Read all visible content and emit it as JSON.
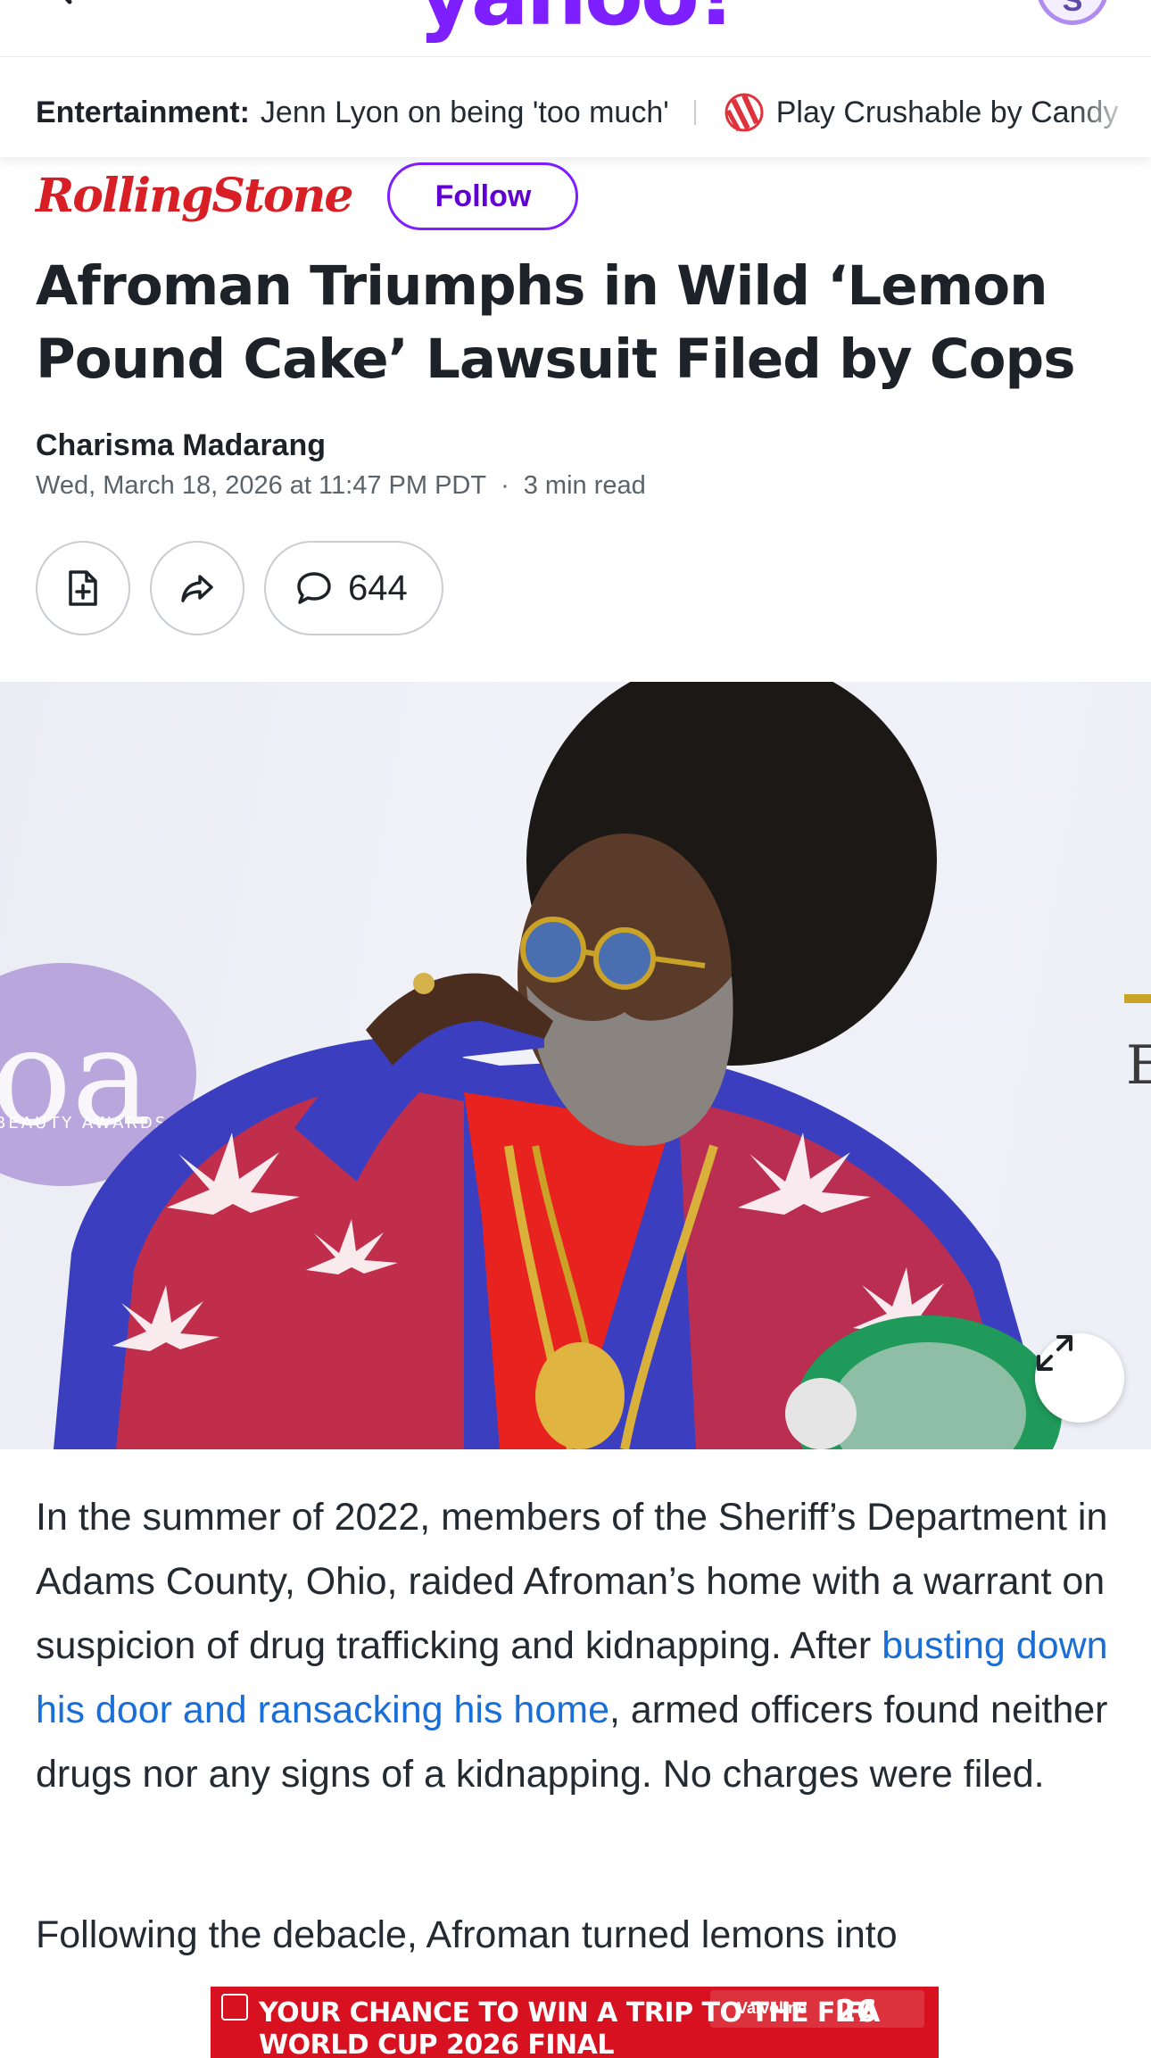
{
  "header": {
    "logo_text": "yahoo!",
    "profile_initial": "S"
  },
  "ticker": {
    "category": "Entertainment:",
    "headline_link": "Jenn Lyon on being 'too much'",
    "promo_text": "Play Crushable by Candy"
  },
  "publisher": {
    "logo_text": "RollingStone",
    "follow_label": "Follow"
  },
  "article": {
    "title": "Afroman Triumphs in Wild ‘Lemon Pound Cake’ Lawsuit Filed by Cops",
    "author": "Charisma Madarang",
    "date": "Wed, March 18, 2026 at 11:47 PM PDT",
    "read_time": "3 min read",
    "separator": "·",
    "comment_count": "644",
    "paragraph1_before": "In the summer of 2022, members of the Sheriff’s Department in Adams County, Ohio, raided Afroman’s home with a warrant on suspicion of drug trafficking and kidnapping. After ",
    "paragraph1_link": "busting down his door and ransacking his home",
    "paragraph1_after": ", armed officers found neither drugs nor any signs of a kidnapping. No charges were filed.",
    "paragraph2": "Following the debacle, Afroman turned lemons into"
  },
  "hero_image": {
    "backdrop_text": "BEAUTY AWARDS"
  },
  "ad": {
    "headline": "YOUR CHANCE TO WIN A TRIP TO THE FIFA WORLD CUP 2026 FINAL",
    "brand": "Valvoline",
    "number": "26"
  },
  "colors": {
    "yahoo_purple": "#7e1fff",
    "rolling_stone_red": "#d81f26",
    "link_blue": "#1a6ed8",
    "ad_red": "#d7111f"
  },
  "icons": [
    "back-chevron-icon",
    "candy-icon",
    "add-document-icon",
    "share-icon",
    "comment-icon",
    "expand-icon",
    "ad-play-icon"
  ]
}
